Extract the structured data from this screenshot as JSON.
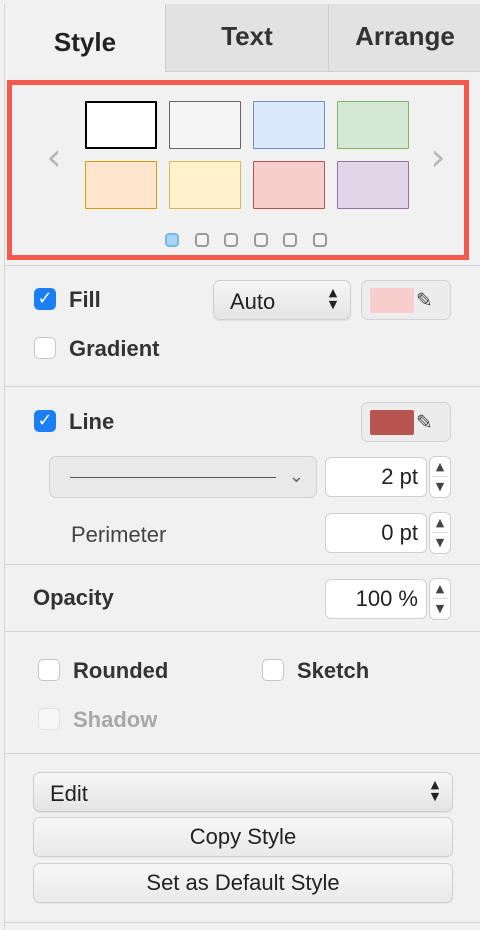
{
  "tabs": [
    "Style",
    "Text",
    "Arrange"
  ],
  "palette": {
    "prev_icon": "chevron-left-icon",
    "next_icon": "chevron-right-icon",
    "swatches": [
      {
        "fill": "#ffffff",
        "stroke": "#000000"
      },
      {
        "fill": "#f5f5f5",
        "stroke": "#666666"
      },
      {
        "fill": "#dae8fc",
        "stroke": "#6c8ebf"
      },
      {
        "fill": "#d5e8d4",
        "stroke": "#82b366"
      },
      {
        "fill": "#ffe6cc",
        "stroke": "#d79b00"
      },
      {
        "fill": "#fff2cc",
        "stroke": "#d6b656"
      },
      {
        "fill": "#f8cecc",
        "stroke": "#b85450"
      },
      {
        "fill": "#e1d5e7",
        "stroke": "#9673a6"
      }
    ],
    "page_count": 6,
    "current_page": 1,
    "highlight_color": "#f4594d"
  },
  "fill": {
    "label": "Fill",
    "checked": true,
    "mode": "Auto",
    "color": "#f8cecc",
    "gradient_label": "Gradient",
    "gradient_checked": false
  },
  "line": {
    "label": "Line",
    "checked": true,
    "color": "#b85450",
    "width": "2 pt",
    "perimeter_label": "Perimeter",
    "perimeter": "0 pt"
  },
  "opacity": {
    "label": "Opacity",
    "value": "100 %"
  },
  "options": {
    "rounded": "Rounded",
    "sketch": "Sketch",
    "shadow": "Shadow"
  },
  "actions": {
    "edit": "Edit",
    "copy_style": "Copy Style",
    "set_default": "Set as Default Style"
  }
}
